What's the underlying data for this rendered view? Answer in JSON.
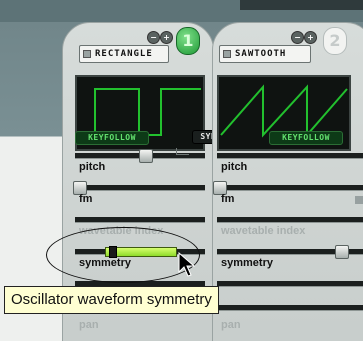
{
  "oscillators": [
    {
      "number": "1",
      "active": true,
      "waveform": "RECTANGLE",
      "keyfollow": "KEYFOLLOW"
    },
    {
      "number": "2",
      "active": false,
      "waveform": "SAWTOOTH",
      "keyfollow": "KEYFOLLOW"
    }
  ],
  "sync_label": "SYNC",
  "minus_label": "−",
  "plus_label": "+",
  "params": {
    "pitch": "pitch",
    "fm": "fm",
    "wavetable_index": "wavetable index",
    "symmetry": "symmetry",
    "pan": "pan"
  },
  "tooltip": "Oscillator waveform symmetry",
  "colors": {
    "accent_green": "#1f9a36",
    "waveform": "#22c02e",
    "tooltip_bg": "#ffffd2"
  }
}
